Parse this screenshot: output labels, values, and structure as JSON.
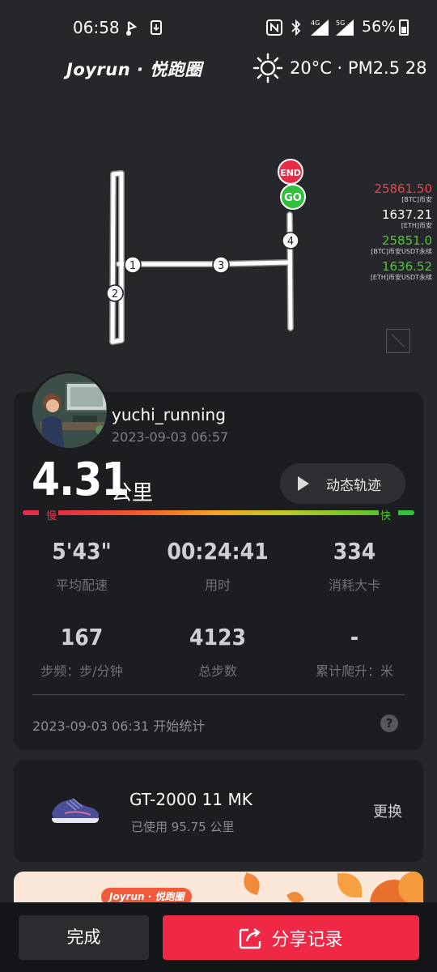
{
  "status_bar": {
    "time": "06:58",
    "battery": "56%",
    "signal_4g": "4G",
    "signal_5g": "5G"
  },
  "header": {
    "brand": "Joyrun · 悦跑圈",
    "weather": "20°C · PM2.5 28"
  },
  "route": {
    "end_label": "END",
    "start_label": "GO",
    "markers": [
      "1",
      "2",
      "3",
      "4"
    ]
  },
  "ticker": [
    {
      "value": "25861.50",
      "label": "[BTC]币安",
      "color": "#e8434c"
    },
    {
      "value": "1637.21",
      "label": "[ETH]币安",
      "color": "#ffffff"
    },
    {
      "value": "25851.0",
      "label": "[BTC]币安USDT永续",
      "color": "#4fc734"
    },
    {
      "value": "1636.52",
      "label": "[ETH]币安USDT永续",
      "color": "#4fc734"
    }
  ],
  "record": {
    "username": "yuchi_running",
    "date": "2023-09-03 06:57",
    "distance": "4.31",
    "distance_unit": "公里",
    "playback_label": "动态轨迹",
    "slow_label": "慢",
    "fast_label": "快",
    "metrics": [
      {
        "value": "5'43\"",
        "label": "平均配速"
      },
      {
        "value": "00:24:41",
        "label": "用时"
      },
      {
        "value": "334",
        "label": "消耗大卡"
      },
      {
        "value": "167",
        "label": "步频：步/分钟"
      },
      {
        "value": "4123",
        "label": "总步数"
      },
      {
        "value": "-",
        "label": "累计爬升：米"
      }
    ],
    "start_stat": "2023-09-03 06:31 开始统计",
    "help": "?"
  },
  "shoe": {
    "name": "GT-2000 11 MK",
    "used": "已使用 95.75 公里",
    "change_label": "更换"
  },
  "banner": {
    "logo": "Joyrun · 悦跑圈"
  },
  "bottom": {
    "done_label": "完成",
    "share_label": "分享记录"
  },
  "colors": {
    "background": "#26272b",
    "card": "#1c1d20",
    "accent": "#ef2846",
    "go": "#2fbf3c",
    "end": "#e62c47"
  }
}
